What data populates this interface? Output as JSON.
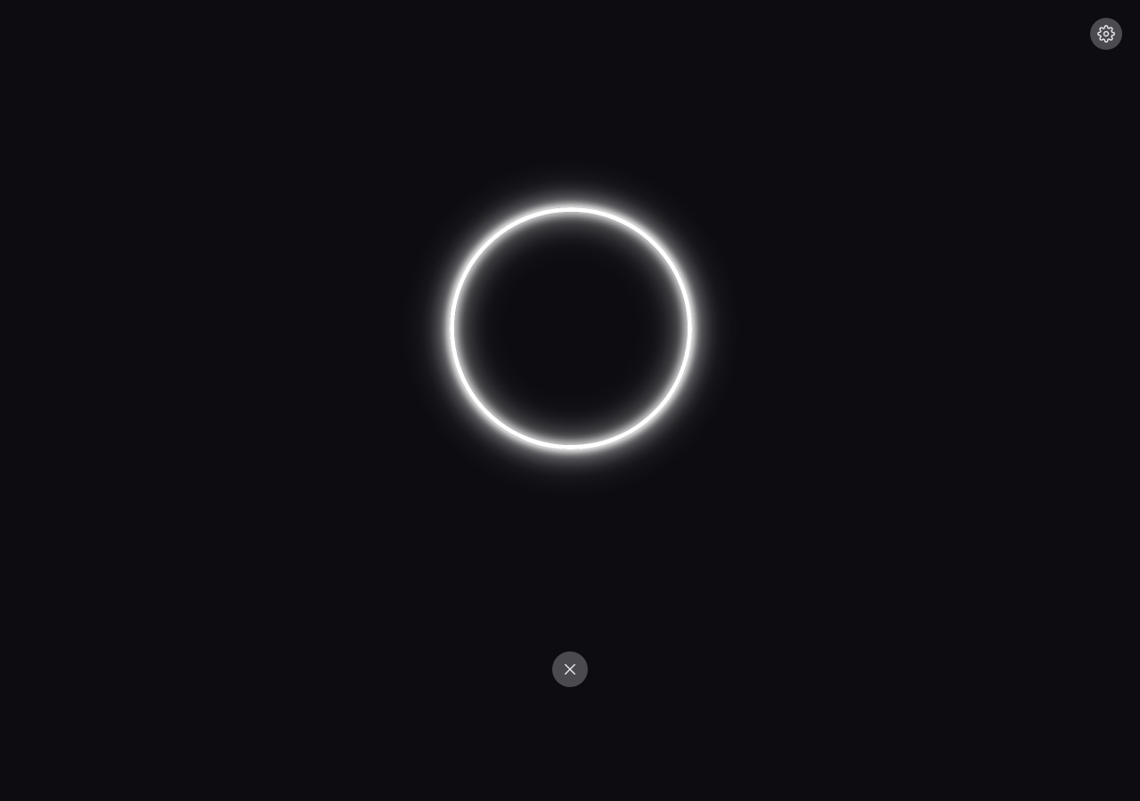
{
  "app": {
    "title": ""
  },
  "colors": {
    "background": "#0c0c11",
    "button_background": "#4a4a4f",
    "icon": "#e6e6ea",
    "ring": "#ffffff"
  },
  "controls": {
    "settings": {
      "icon": "gear-icon"
    },
    "close": {
      "icon": "close-icon"
    }
  },
  "indicator": {
    "type": "glowing-ring"
  }
}
